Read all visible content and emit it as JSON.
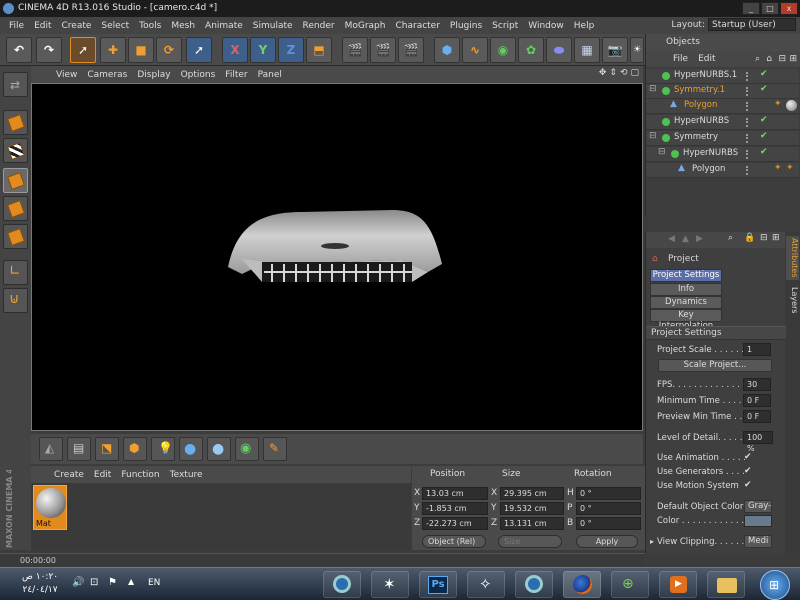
{
  "window": {
    "title": "CINEMA 4D R13.016 Studio - [camero.c4d *]",
    "buttons": [
      "_",
      "□",
      "x"
    ]
  },
  "menu": [
    "File",
    "Edit",
    "Create",
    "Select",
    "Tools",
    "Mesh",
    "Animate",
    "Simulate",
    "Render",
    "MoGraph",
    "Character",
    "Plugins",
    "Script",
    "Window",
    "Help"
  ],
  "layout": {
    "label": "Layout:",
    "value": "Startup (User)"
  },
  "toolbar": {
    "axis_x": "X",
    "axis_y": "Y",
    "axis_z": "Z"
  },
  "viewport": {
    "menu": [
      "View",
      "Cameras",
      "Display",
      "Options",
      "Filter",
      "Panel"
    ]
  },
  "materials": {
    "menu": [
      "Create",
      "Edit",
      "Function",
      "Texture"
    ],
    "items": [
      {
        "name": "Mat"
      }
    ],
    "brand": "MAXON CINEMA 4D"
  },
  "coordinates": {
    "headers": {
      "position": "Position",
      "size": "Size",
      "rotation": "Rotation"
    },
    "rows": [
      {
        "axis": "X",
        "pos": "13.03 cm",
        "size_axis": "X",
        "size": "29.395 cm",
        "rot_axis": "H",
        "rot": "0 °"
      },
      {
        "axis": "Y",
        "pos": "-1.853 cm",
        "size_axis": "Y",
        "size": "19.532 cm",
        "rot_axis": "P",
        "rot": "0 °"
      },
      {
        "axis": "Z",
        "pos": "-22.273 cm",
        "size_axis": "Z",
        "size": "13.131 cm",
        "rot_axis": "B",
        "rot": "0 °"
      }
    ],
    "mode": "Object (Rel)",
    "size_mode": "Size",
    "apply": "Apply"
  },
  "status": {
    "time": "00:00:00"
  },
  "objects": {
    "title": "Objects",
    "menu": [
      "File",
      "Edit"
    ],
    "tree": [
      {
        "name": "HyperNURBS.1",
        "indent": 1,
        "color": "normal",
        "icon": "nurbs"
      },
      {
        "name": "Symmetry.1",
        "indent": 1,
        "color": "orange",
        "icon": "symmetry"
      },
      {
        "name": "Polygon",
        "indent": 2,
        "color": "orange",
        "icon": "polygon"
      },
      {
        "name": "HyperNURBS",
        "indent": 1,
        "color": "normal",
        "icon": "nurbs"
      },
      {
        "name": "Symmetry",
        "indent": 1,
        "color": "normal",
        "icon": "symmetry"
      },
      {
        "name": "HyperNURBS",
        "indent": 2,
        "color": "normal",
        "icon": "nurbs"
      },
      {
        "name": "Polygon",
        "indent": 3,
        "color": "normal",
        "icon": "polygon"
      }
    ]
  },
  "attributes": {
    "object": "Project",
    "tabs": [
      "Project Settings",
      "Info",
      "Dynamics",
      "Key Interpolation"
    ],
    "section": "Project Settings",
    "side_tabs": [
      "Attributes",
      "Layers"
    ],
    "fields": {
      "project_scale": {
        "label": "Project Scale . . . . . . .",
        "value": "1"
      },
      "scale_project": "Scale Project...",
      "fps": {
        "label": "FPS. . . . . . . . . . . . . . . .",
        "value": "30"
      },
      "min_time": {
        "label": "Minimum Time . . . . .",
        "value": "0 F"
      },
      "preview_min": {
        "label": "Preview Min Time . . .",
        "value": "0 F"
      },
      "lod": {
        "label": "Level of Detail. . . . . .",
        "value": "100 %"
      },
      "use_animation": {
        "label": "Use Animation . . . . .",
        "value": "✔"
      },
      "use_generators": {
        "label": "Use Generators . . . .",
        "value": "✔"
      },
      "use_motion": {
        "label": "Use Motion System",
        "value": "✔"
      },
      "default_color": {
        "label": "Default Object Color",
        "value": "Gray-"
      },
      "color": {
        "label": "Color . . . . . . . . . . . ."
      },
      "view_clipping": {
        "label": "View Clipping. . . . . . .",
        "value": "Medi"
      }
    }
  },
  "taskbar": {
    "time": "١٠:٢٠ ص",
    "date": "٢٤/٠٤/١٧",
    "lang": "EN",
    "apps": [
      "cinema4d-app-icon",
      "zbrush-app-icon",
      "photoshop-app-icon",
      "unity-app-icon",
      "cinema4d-app-icon",
      "firefox-app-icon",
      "network-app-icon",
      "media-player-app-icon",
      "explorer-app-icon",
      "start-button"
    ],
    "photoshop_label": "Ps"
  },
  "colors": {
    "accent": "#e08a20",
    "selection": "#5d6fa8",
    "panel": "#444444"
  }
}
